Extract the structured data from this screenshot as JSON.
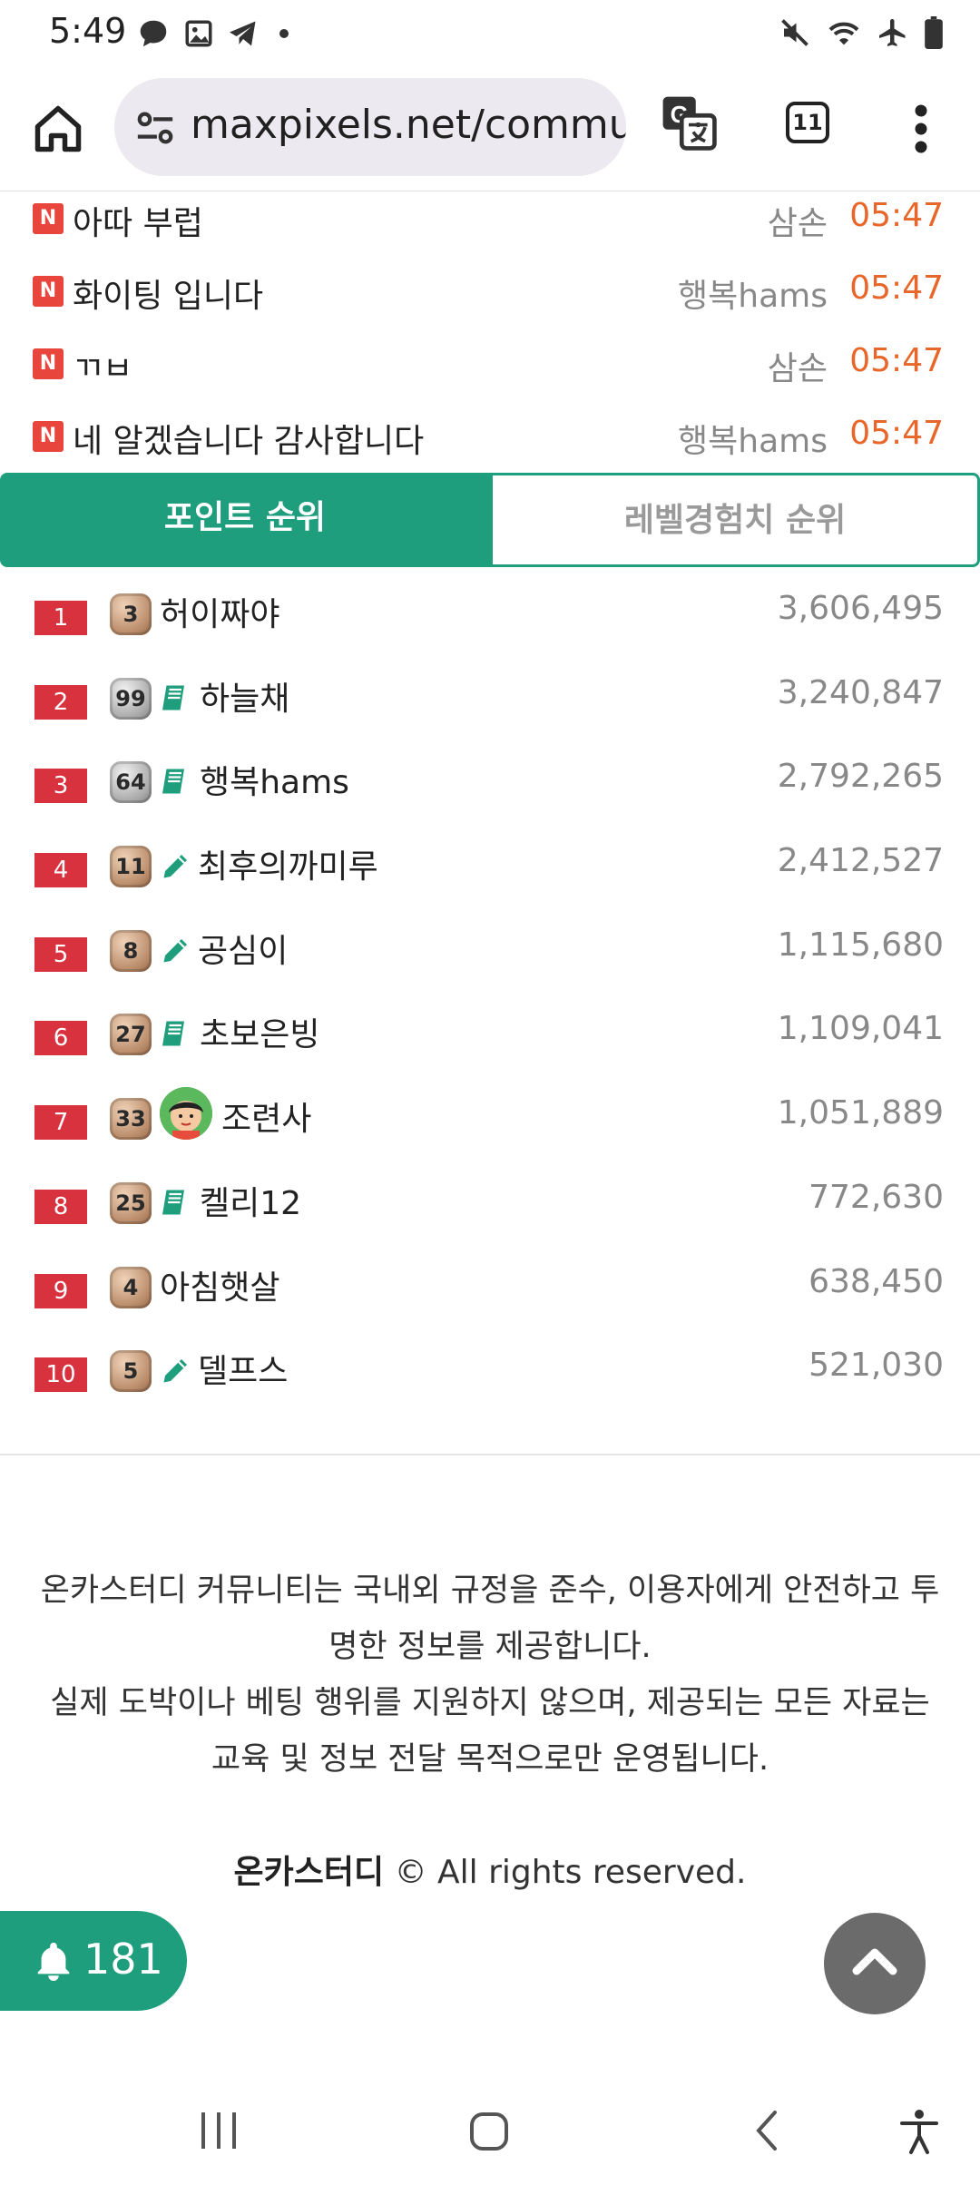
{
  "status_bar": {
    "time": "5:49",
    "left_icons": [
      "chat-bubble-icon",
      "image-icon",
      "telegram-icon"
    ],
    "right_icons": [
      "mute-icon",
      "wifi-icon",
      "airplane-icon",
      "battery-icon"
    ]
  },
  "browser": {
    "url": "maxpixels.net/community",
    "tab_count": "11",
    "icons": [
      "home-icon",
      "site-info-icon",
      "translate-icon",
      "tabs-icon",
      "more-menu-icon"
    ]
  },
  "feed": {
    "items": [
      {
        "badge": "N",
        "title": "아따 부럽",
        "author": "삼손",
        "time": "05:47"
      },
      {
        "badge": "N",
        "title": "화이팅 입니다",
        "author": "행복hams",
        "time": "05:47"
      },
      {
        "badge": "N",
        "title": "ㄲㅂ",
        "author": "삼손",
        "time": "05:47"
      },
      {
        "badge": "N",
        "title": "네 알겠습니다 감사합니다",
        "author": "행복hams",
        "time": "05:47"
      }
    ]
  },
  "rank_tabs": {
    "active": "포인트 순위",
    "inactive": "레벨경험치 순위"
  },
  "ranking": [
    {
      "rank": "1",
      "level": "3",
      "level_style": "bronze",
      "icon": "none",
      "name": "허이짜야",
      "points": "3,606,495"
    },
    {
      "rank": "2",
      "level": "99",
      "level_style": "silver",
      "icon": "book-icon",
      "name": "하늘채",
      "points": "3,240,847"
    },
    {
      "rank": "3",
      "level": "64",
      "level_style": "silver",
      "icon": "book-icon",
      "name": "행복hams",
      "points": "2,792,265"
    },
    {
      "rank": "4",
      "level": "11",
      "level_style": "bronze",
      "icon": "pencil-icon",
      "name": "최후의까미루",
      "points": "2,412,527"
    },
    {
      "rank": "5",
      "level": "8",
      "level_style": "bronze",
      "icon": "pencil-icon",
      "name": "공심이",
      "points": "1,115,680"
    },
    {
      "rank": "6",
      "level": "27",
      "level_style": "bronze",
      "icon": "book-icon",
      "name": "초보은빙",
      "points": "1,109,041"
    },
    {
      "rank": "7",
      "level": "33",
      "level_style": "bronze",
      "icon": "avatar",
      "name": "조련사",
      "points": "1,051,889"
    },
    {
      "rank": "8",
      "level": "25",
      "level_style": "bronze",
      "icon": "book-icon",
      "name": "켈리12",
      "points": "772,630"
    },
    {
      "rank": "9",
      "level": "4",
      "level_style": "bronze",
      "icon": "none",
      "name": "아침햇살",
      "points": "638,450"
    },
    {
      "rank": "10",
      "level": "5",
      "level_style": "bronze",
      "icon": "pencil-icon",
      "name": "델프스",
      "points": "521,030"
    }
  ],
  "footer": {
    "line1": "온카스터디 커뮤니티는 국내외 규정을 준수, 이용자에게 안전하고 투명한 정보를 제공합니다.",
    "line2": "실제 도박이나 베팅 행위를 지원하지 않으며, 제공되는 모든 자료는 교육 및 정보 전달 목적으로만 운영됩니다.",
    "brand": "온카스터디",
    "copyright": "© All rights reserved."
  },
  "notification": {
    "count": "181"
  },
  "colors": {
    "accent": "#1f9e7d",
    "rank_badge": "#d9323f",
    "new_badge": "#e8453c",
    "time": "#e8662a"
  }
}
